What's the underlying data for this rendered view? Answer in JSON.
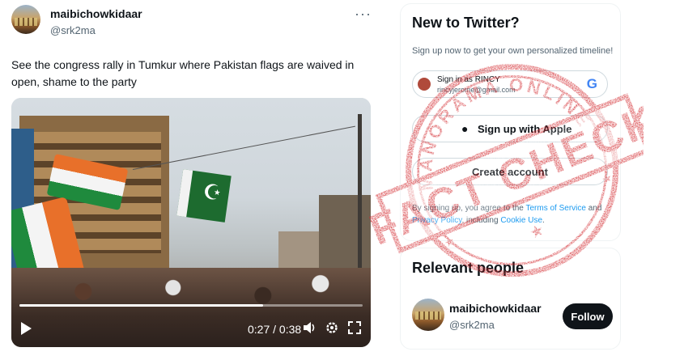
{
  "tweet": {
    "user_name": "maibichowkidaar",
    "user_handle": "@srk2ma",
    "text": "See the congress rally in Tumkur where Pakistan flags are waived in open, shame to the party",
    "more_icon": "more-dots-icon"
  },
  "video": {
    "time": "0:27 / 0:38",
    "progress": 0.71,
    "icons": [
      "play-icon",
      "volume-icon",
      "settings-icon",
      "fullscreen-icon"
    ]
  },
  "sidebar": {
    "signup": {
      "title": "New to Twitter?",
      "subtitle": "Sign up now to get your own personalized timeline!",
      "google_line1": "Sign in as RINCY",
      "google_line2": "rincyjerome@gmail.com",
      "apple_label": "Sign up with Apple",
      "create_label": "Create account",
      "legal_prefix": "By signing up, you agree to the ",
      "terms_link": "Terms of Service",
      "legal_and": " and ",
      "privacy_link": "Privacy Policy",
      "legal_mid": ", including ",
      "cookie_link": "Cookie Use",
      "legal_end": "."
    },
    "people": {
      "title": "Relevant people",
      "name": "maibichowkidaar",
      "handle": "@srk2ma",
      "follow_label": "Follow"
    }
  },
  "stamp": {
    "top_text": "MANORAMA ONLINE",
    "main_text": "FACT CHECK",
    "color": "#d32a2f"
  }
}
